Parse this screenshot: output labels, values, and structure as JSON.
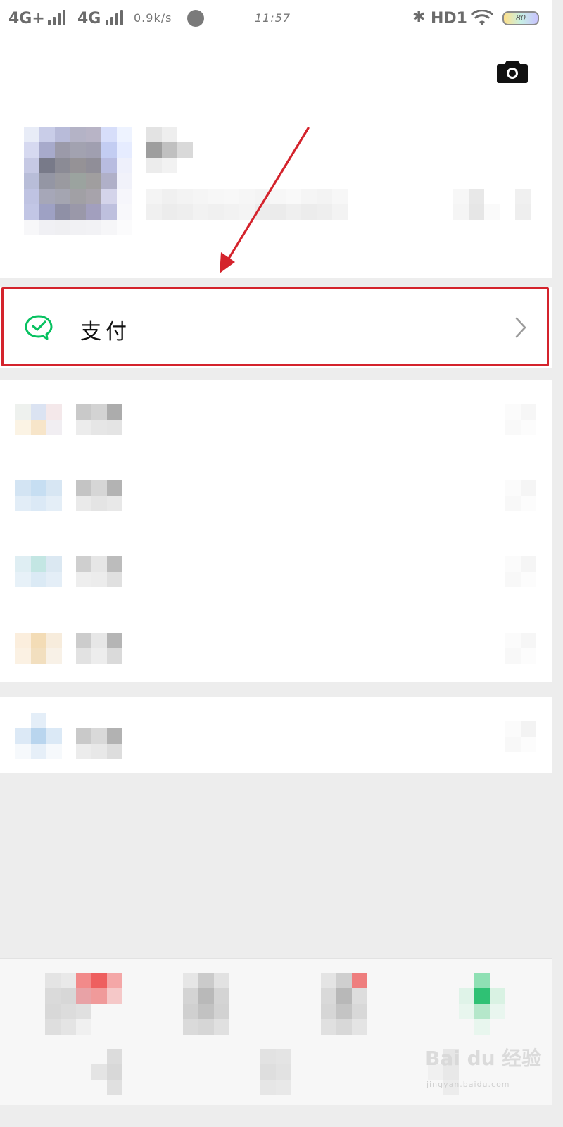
{
  "status_bar": {
    "net1": "4G+",
    "net2": "4G",
    "speed": "0.9k/s",
    "time": "11:57",
    "bluetooth_icon": "bluetooth-icon",
    "hd": "HD1",
    "battery": "80"
  },
  "header": {
    "camera_icon": "camera-icon"
  },
  "payment": {
    "label": "支付",
    "icon": "wechat-pay-icon",
    "chevron": "chevron-right-icon",
    "accent": "#07c160",
    "highlight_color": "#d4232c"
  },
  "annotation": {
    "arrow_color": "#d4232c"
  },
  "watermark": {
    "text": "Bai du 经验",
    "sub": "jingyan.baidu.com"
  }
}
